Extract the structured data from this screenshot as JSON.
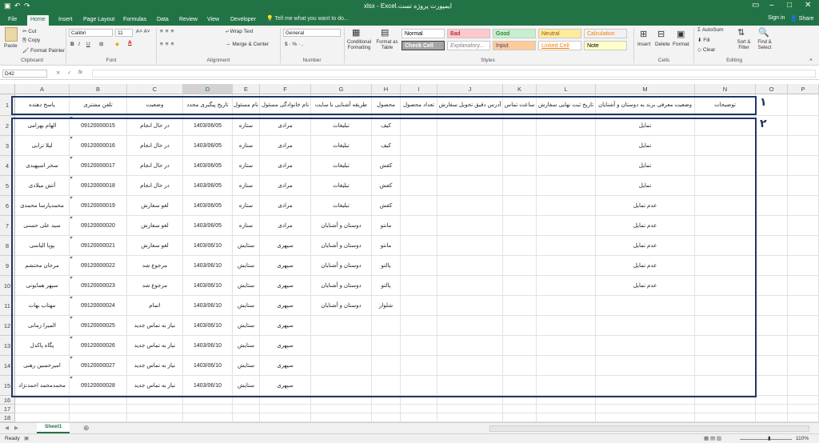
{
  "window": {
    "title": "ایمپورت پروژه تست.xlsx - Excel",
    "sign_in": "Sign in",
    "share": "Share"
  },
  "tabs": [
    "File",
    "Home",
    "Insert",
    "Page Layout",
    "Formulas",
    "Data",
    "Review",
    "View",
    "Developer"
  ],
  "active_tab": "Home",
  "tell_me": "Tell me what you want to do...",
  "ribbon": {
    "clipboard": {
      "paste": "Paste",
      "cut": "Cut",
      "copy": "Copy",
      "format_painter": "Format Painter",
      "label": "Clipboard"
    },
    "font": {
      "name": "Calibri",
      "size": "11",
      "label": "Font"
    },
    "alignment": {
      "wrap": "Wrap Text",
      "merge": "Merge & Center",
      "label": "Alignment"
    },
    "number": {
      "format": "General",
      "label": "Number"
    },
    "styles": {
      "conditional": "Conditional Formatting",
      "format_table": "Format as Table",
      "cells": [
        {
          "name": "Normal",
          "bg": "#ffffff",
          "fg": "#000000"
        },
        {
          "name": "Bad",
          "bg": "#ffc7ce",
          "fg": "#9c0006"
        },
        {
          "name": "Good",
          "bg": "#c6efce",
          "fg": "#006100"
        },
        {
          "name": "Neutral",
          "bg": "#ffeb9c",
          "fg": "#9c5700"
        },
        {
          "name": "Calculation",
          "bg": "#f2f2f2",
          "fg": "#fa7d00"
        },
        {
          "name": "Check Cell",
          "bg": "#a5a5a5",
          "fg": "#ffffff"
        },
        {
          "name": "Explanatory...",
          "bg": "#ffffff",
          "fg": "#7f7f7f"
        },
        {
          "name": "Input",
          "bg": "#ffcc99",
          "fg": "#3f3f76"
        },
        {
          "name": "Linked Cell",
          "bg": "#ffffff",
          "fg": "#fa7d00"
        },
        {
          "name": "Note",
          "bg": "#ffffcc",
          "fg": "#000000"
        }
      ],
      "label": "Styles"
    },
    "cells": {
      "insert": "Insert",
      "delete": "Delete",
      "format": "Format",
      "label": "Cells"
    },
    "editing": {
      "autosum": "AutoSum",
      "fill": "Fill",
      "clear": "Clear",
      "sort": "Sort & Filter",
      "find": "Find & Select",
      "label": "Editing"
    }
  },
  "formula_bar": {
    "name_box": "D42",
    "fx": "fx",
    "value": ""
  },
  "columns": [
    "A",
    "B",
    "C",
    "D",
    "E",
    "F",
    "G",
    "H",
    "I",
    "J",
    "K",
    "L",
    "M",
    "N",
    "O",
    "P"
  ],
  "headers": {
    "A": "پاسخ دهنده",
    "B": "تلفن مشتری",
    "C": "وضعیت",
    "D": "تاریخ پیگیری مجدد",
    "E": "نام مسئول",
    "F": "نام خانوادگی مسئول",
    "G": "طریقه آشنایی با سایت",
    "H": "محصول",
    "I": "تعداد محصول",
    "J": "آدرس دقیق تحویل سفارش",
    "K": "ساعت تماس",
    "L": "تاریخ ثبت نهایی سفارش",
    "M": "وضعیت معرفی برند به دوستان و آشنایان",
    "N": "توضیحات"
  },
  "rows": [
    {
      "A": "الهام بهرامی",
      "B": "09120000015",
      "C": "در حال انجام",
      "D": "1403/06/05",
      "E": "ستاره",
      "F": "مرادی",
      "G": "تبلیغات",
      "H": "کیف",
      "M": "تمایل"
    },
    {
      "A": "لیلا ترابی",
      "B": "09120000016",
      "C": "در حال انجام",
      "D": "1403/06/05",
      "E": "ستاره",
      "F": "مرادی",
      "G": "تبلیغات",
      "H": "کیف",
      "M": "تمایل"
    },
    {
      "A": "سحر اسپهبدی",
      "B": "09120000017",
      "C": "در حال انجام",
      "D": "1403/06/05",
      "E": "ستاره",
      "F": "مرادی",
      "G": "تبلیغات",
      "H": "کفش",
      "M": "تمایل"
    },
    {
      "A": "آتش میلادی",
      "B": "09120000018",
      "C": "در حال انجام",
      "D": "1403/06/05",
      "E": "ستاره",
      "F": "مرادی",
      "G": "تبلیغات",
      "H": "کفش",
      "M": "تمایل"
    },
    {
      "A": "محمدپارسا محمدی",
      "B": "09120000019",
      "C": "لغو سفارش",
      "D": "1403/06/05",
      "E": "ستاره",
      "F": "مرادی",
      "G": "تبلیغات",
      "H": "کفش",
      "M": "عدم تمایل"
    },
    {
      "A": "سید علی حسنی",
      "B": "09120000020",
      "C": "لغو سفارش",
      "D": "1403/06/05",
      "E": "ستاره",
      "F": "مرادی",
      "G": "دوستان و آشنایان",
      "H": "مانتو",
      "M": "عدم تمایل"
    },
    {
      "A": "پویا الیاسی",
      "B": "09120000021",
      "C": "لغو سفارش",
      "D": "1403/06/10",
      "E": "ستایش",
      "F": "سپهری",
      "G": "دوستان و آشنایان",
      "H": "مانتو",
      "M": "عدم تمایل"
    },
    {
      "A": "مرجان محتشم",
      "B": "09120000022",
      "C": "مرجوع شد",
      "D": "1403/06/10",
      "E": "ستایش",
      "F": "سپهری",
      "G": "دوستان و آشنایان",
      "H": "پالتو",
      "M": "عدم تمایل"
    },
    {
      "A": "سپهر همایونی",
      "B": "09120000023",
      "C": "مرجوع شد",
      "D": "1403/06/10",
      "E": "ستایش",
      "F": "سپهری",
      "G": "دوستان و آشنایان",
      "H": "پالتو",
      "M": "عدم تمایل"
    },
    {
      "A": "مهتاب بهات",
      "B": "09120000024",
      "C": "اتمام",
      "D": "1403/06/10",
      "E": "ستایش",
      "F": "سپهری",
      "G": "دوستان و آشنایان",
      "H": "شلوار",
      "M": ""
    },
    {
      "A": "المیرا زمانی",
      "B": "09120000025",
      "C": "نیاز به تماس جدید",
      "D": "1403/06/10",
      "E": "ستایش",
      "F": "سپهری",
      "G": "",
      "H": "",
      "M": ""
    },
    {
      "A": "پگاه پاکدل",
      "B": "09120000026",
      "C": "نیاز به تماس جدید",
      "D": "1403/06/10",
      "E": "ستایش",
      "F": "سپهری",
      "G": "",
      "H": "",
      "M": ""
    },
    {
      "A": "امیرحسین رهنی",
      "B": "09120000027",
      "C": "نیاز به تماس جدید",
      "D": "1403/06/10",
      "E": "ستایش",
      "F": "سپهری",
      "G": "",
      "H": "",
      "M": ""
    },
    {
      "A": "محمدمحمد احمدنژاد",
      "B": "09120000028",
      "C": "نیاز به تماس جدید",
      "D": "1403/06/10",
      "E": "ستایش",
      "F": "سپهری",
      "G": "",
      "H": "",
      "M": ""
    }
  ],
  "row_numbers": [
    "1",
    "2",
    "3",
    "4",
    "5",
    "6",
    "7",
    "8",
    "9",
    "10",
    "11",
    "12",
    "13",
    "14",
    "15",
    "16",
    "17",
    "18"
  ],
  "annotations": [
    "۱",
    "۲"
  ],
  "sheet_tab": "Sheet1",
  "status": {
    "ready": "Ready",
    "zoom": "110%"
  },
  "colors": {
    "brand": "#217346",
    "annotation": "#1f3864"
  }
}
